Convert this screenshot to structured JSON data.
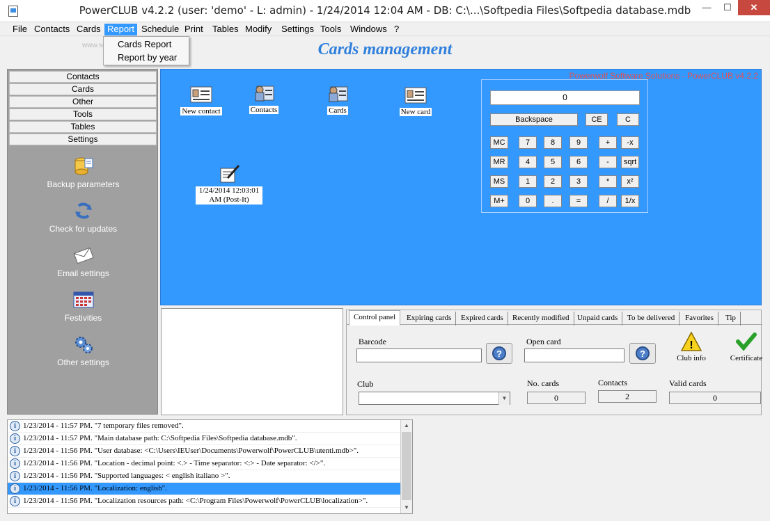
{
  "window": {
    "title": "PowerCLUB v4.2.2  (user: 'demo'  - L: admin) - 1/24/2014 12:04 AM - DB: C:\\...\\Softpedia Files\\Softpedia database.mdb",
    "min": "—",
    "max": "☐",
    "close": "✕"
  },
  "menu": {
    "items": [
      "File",
      "Contacts",
      "Cards",
      "Report",
      "Schedule",
      "Print",
      "Tables",
      "Modify",
      "Settings",
      "Tools",
      "Windows",
      "?"
    ],
    "active": "Report",
    "report_dropdown": [
      "Cards Report",
      "Report by year"
    ]
  },
  "header": {
    "title": "Cards management",
    "watermark": "www.softpedia.com"
  },
  "sidebar": {
    "sections": [
      "Contacts",
      "Cards",
      "Other",
      "Tools",
      "Tables",
      "Settings"
    ],
    "tools": [
      {
        "label": "Backup parameters",
        "icon": "database-icon"
      },
      {
        "label": "Check for updates",
        "icon": "refresh-icon"
      },
      {
        "label": "Email settings",
        "icon": "envelope-icon"
      },
      {
        "label": "Festivities",
        "icon": "calendar-icon"
      },
      {
        "label": "Other settings",
        "icon": "gears-icon"
      }
    ]
  },
  "desktop": {
    "brand": "Powerwolf Software Solutions - PowerCLUB v4.2.2",
    "icons": [
      {
        "label": "New contact",
        "icon": "contact-card-icon"
      },
      {
        "label": "Contacts",
        "icon": "contacts-icon"
      },
      {
        "label": "Cards",
        "icon": "cards-icon"
      },
      {
        "label": "New card",
        "icon": "new-card-icon"
      }
    ],
    "postit": {
      "label": "1/24/2014 12:03:01 AM (Post-It)",
      "icon": "note-icon"
    }
  },
  "calculator": {
    "display": "0",
    "top_buttons": [
      "Backspace",
      "CE",
      "C"
    ],
    "rows": [
      [
        "MC",
        "7",
        "8",
        "9",
        "+",
        "-x"
      ],
      [
        "MR",
        "4",
        "5",
        "6",
        "-",
        "sqrt"
      ],
      [
        "MS",
        "1",
        "2",
        "3",
        "*",
        "x²"
      ],
      [
        "M+",
        "0",
        ".",
        "=",
        "/",
        "1/x"
      ]
    ]
  },
  "tabs": {
    "items": [
      "Control panel",
      "Expiring cards",
      "Expired cards",
      "Recently modified",
      "Unpaid cards",
      "To be delivered",
      "Favorites",
      "Tip"
    ],
    "active": "Control panel"
  },
  "control_panel": {
    "barcode_label": "Barcode",
    "open_card_label": "Open card",
    "club_label": "Club",
    "no_cards_label": "No. cards",
    "no_cards_value": "0",
    "contacts_label": "Contacts",
    "contacts_value": "2",
    "valid_cards_label": "Valid cards",
    "valid_cards_value": "0",
    "club_info_label": "Club info",
    "certificate_label": "Certificate",
    "help_glyph": "?",
    "warning_glyph": "!"
  },
  "log": {
    "selected_index": 5,
    "info_glyph": "i",
    "entries": [
      "1/23/2014 - 11:57 PM. \"7 temporary files removed\".",
      "1/23/2014 - 11:57 PM. \"Main database path: C:\\Softpedia Files\\Softpedia database.mdb\".",
      "1/23/2014 - 11:56 PM. \"User database: <C:\\Users\\IEUser\\Documents\\Powerwolf\\PowerCLUB\\utenti.mdb>\".",
      "1/23/2014 - 11:56 PM. \"Location - decimal point: <.> - Time separator: <:> - Date separator: </>\".",
      "1/23/2014 - 11:56 PM. \"Supported languages: < english italiano >\".",
      "1/23/2014 - 11:56 PM. \"Localization: english\".",
      "1/23/2014 - 11:56 PM. \"Localization resources path: <C:\\Program Files\\Powerwolf\\PowerCLUB\\localization>\"."
    ]
  },
  "colors": {
    "desktop": "#3399ff",
    "title_accent": "#2f7fdc",
    "sidebar": "#a0a0a0",
    "close": "#c7483f"
  }
}
